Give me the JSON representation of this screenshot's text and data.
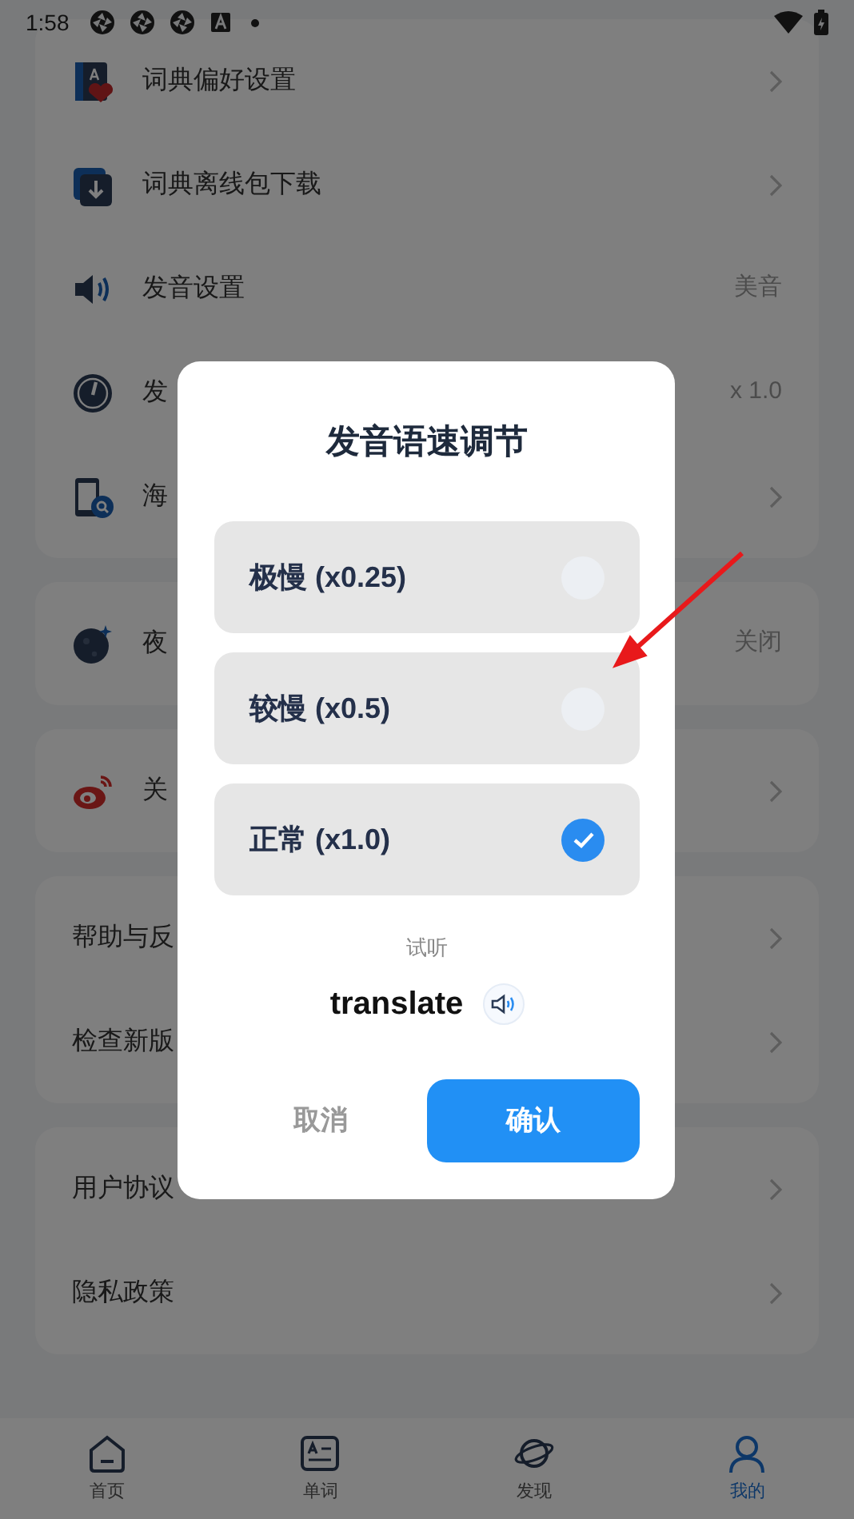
{
  "status_bar": {
    "time": "1:58"
  },
  "settings_groups": [
    {
      "items": [
        {
          "label": "词典偏好设置"
        },
        {
          "label": "词典离线包下载"
        },
        {
          "label": "发音设置",
          "value": "美音"
        },
        {
          "label": "发",
          "value": "x 1.0"
        },
        {
          "label": "海"
        }
      ]
    },
    {
      "items": [
        {
          "label": "夜",
          "value": "关闭"
        }
      ]
    },
    {
      "items": [
        {
          "label": "关"
        }
      ]
    },
    {
      "items": [
        {
          "label": "帮助与反"
        },
        {
          "label": "检查新版"
        }
      ]
    },
    {
      "items": [
        {
          "label": "用户协议"
        },
        {
          "label": "隐私政策"
        }
      ]
    }
  ],
  "dialog": {
    "title": "发音语速调节",
    "options": [
      {
        "label": "极慢 (x0.25)",
        "selected": false
      },
      {
        "label": "较慢 (x0.5)",
        "selected": false
      },
      {
        "label": "正常 (x1.0)",
        "selected": true
      }
    ],
    "preview_label": "试听",
    "preview_word": "translate",
    "cancel": "取消",
    "confirm": "确认"
  },
  "bottom_nav": [
    {
      "label": "首页",
      "selected": false
    },
    {
      "label": "单词",
      "selected": false
    },
    {
      "label": "发现",
      "selected": false
    },
    {
      "label": "我的",
      "selected": true
    }
  ]
}
